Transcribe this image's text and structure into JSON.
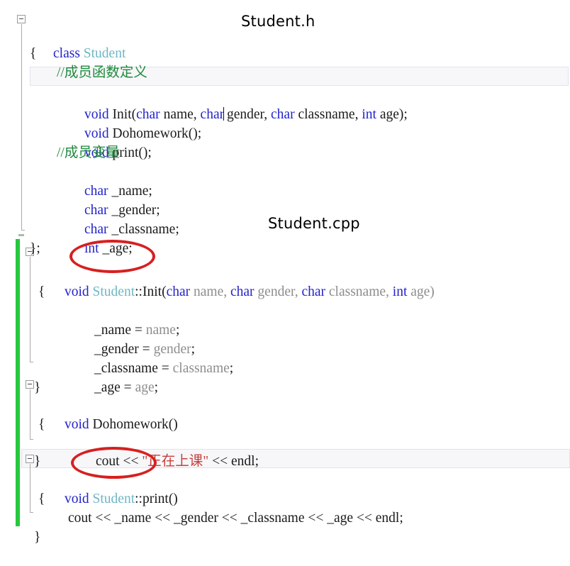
{
  "window": {
    "type": "code-editor",
    "language": "C++",
    "background": "#ffffff"
  },
  "theme": {
    "keyword_color": "#2222cc",
    "class_name_color": "#6fb7c4",
    "comment_color": "#1e8a3c",
    "string_color": "#c7413d",
    "parameter_color": "#8d8d8d",
    "plain_color": "#1a1a1a",
    "change_bar_color": "#27c83e",
    "annotation_color": "#d62020",
    "active_line_background": "#f7f7f9"
  },
  "overlays": {
    "header_label": "Student.h",
    "cpp_label": "Student.cpp"
  },
  "annotations": [
    {
      "name": "ellipse-student-init",
      "target": "Student::"
    },
    {
      "name": "ellipse-student-print",
      "target": "Student::"
    }
  ],
  "code": {
    "line_01": {
      "kw1": "class",
      "name": "Student"
    },
    "line_02": {
      "text": "{"
    },
    "line_03": {
      "comment": "//成员函数定义"
    },
    "line_04": {
      "kw1": "void",
      "fn": " Init(",
      "kw2": "char",
      "p1": " name, ",
      "kw3": "char",
      "p2": " gender, ",
      "kw4": "char",
      "p3": " classname, ",
      "kw5": "int",
      "p4": " age);"
    },
    "line_05": {
      "kw1": "void",
      "rest": " Dohomework();"
    },
    "line_06": {
      "kw1": "void",
      "rest": " print();"
    },
    "line_07": {
      "comment": "//成员变量"
    },
    "line_08": {
      "kw1": "char",
      "rest": " _name;"
    },
    "line_09": {
      "kw1": "char",
      "rest": " _gender;"
    },
    "line_10": {
      "kw1": "char",
      "rest": " _classname;"
    },
    "line_11": {
      "kw1": "int",
      "rest": " _age;"
    },
    "line_12": {
      "text": "};"
    },
    "line_13": {
      "kw1": "void",
      "sp1": " ",
      "cls": "Student",
      "scope": "::",
      "fn": "Init(",
      "kw2": "char",
      "p1": " name, ",
      "kw3": "char",
      "p2": " gender, ",
      "kw4": "char",
      "p3": " classname, ",
      "kw5": "int",
      "p4": " age)"
    },
    "line_14": {
      "text": "{"
    },
    "line_15": {
      "lhs": "_name = ",
      "rhs": "name",
      "semi": ";"
    },
    "line_16": {
      "lhs": "_gender = ",
      "rhs": "gender",
      "semi": ";"
    },
    "line_17": {
      "lhs": "_classname = ",
      "rhs": "classname",
      "semi": ";"
    },
    "line_18": {
      "lhs": "_age = ",
      "rhs": "age",
      "semi": ";"
    },
    "line_19": {
      "text": "}"
    },
    "line_20": {
      "kw1": "void",
      "rest": " Dohomework()"
    },
    "line_21": {
      "text": "{"
    },
    "line_22": {
      "pre": "cout << ",
      "str": "\"正在上课\"",
      "post": " << endl;"
    },
    "line_23": {
      "text": "}"
    },
    "line_24": {
      "kw1": "void",
      "sp1": " ",
      "cls": "Student",
      "scope": "::",
      "fn": "print()"
    },
    "line_25": {
      "text": "{"
    },
    "line_26": {
      "text": "cout << _name << _gender << _classname << _age << endl;"
    },
    "line_27": {
      "text": "}"
    }
  }
}
